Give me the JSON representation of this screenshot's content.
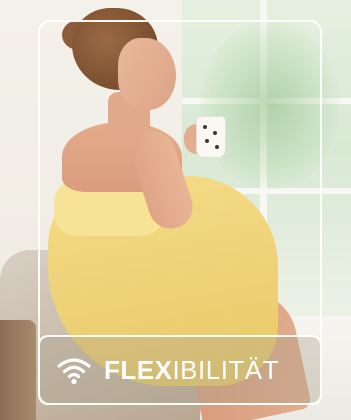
{
  "image": {
    "description_tag": "photo-card",
    "colors": {
      "dress": "#f2d77f",
      "frame": "#ffffff",
      "label_text": "#ffffff",
      "window_green": "#d8e9d4"
    }
  },
  "label": {
    "icon": "wifi-icon",
    "bold": "FLEX",
    "light": "IBILITÄT"
  }
}
